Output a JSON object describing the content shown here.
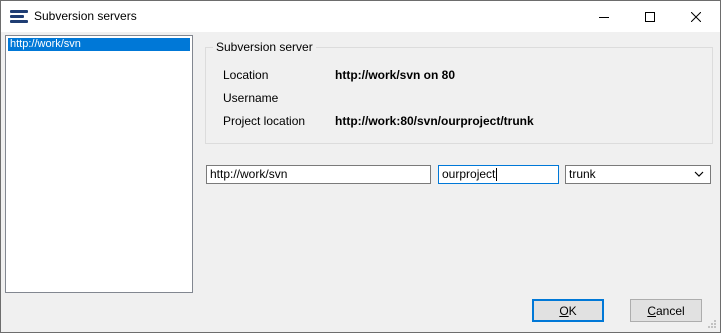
{
  "window": {
    "title": "Subversion servers",
    "icon": "subversion-app-icon",
    "controls": [
      "minimize-icon",
      "maximize-icon",
      "close-icon"
    ]
  },
  "server_list": {
    "items": [
      {
        "label": "http://work/svn",
        "selected": true
      }
    ]
  },
  "server_group": {
    "title": "Subversion server",
    "rows": [
      {
        "label": "Location",
        "value": "http://work/svn on 80"
      },
      {
        "label": "Username",
        "value": ""
      },
      {
        "label": "Project location",
        "value": "http://work:80/svn/ourproject/trunk"
      }
    ]
  },
  "fields": {
    "server_url": "http://work/svn",
    "project": "ourproject",
    "branch": "trunk"
  },
  "buttons": {
    "ok": {
      "accel": "O",
      "rest": "K"
    },
    "cancel": {
      "accel": "C",
      "rest": "ancel"
    }
  },
  "colors": {
    "selection": "#0078d7",
    "focus_border": "#0078d7",
    "app_icon": "#1f3d73"
  }
}
